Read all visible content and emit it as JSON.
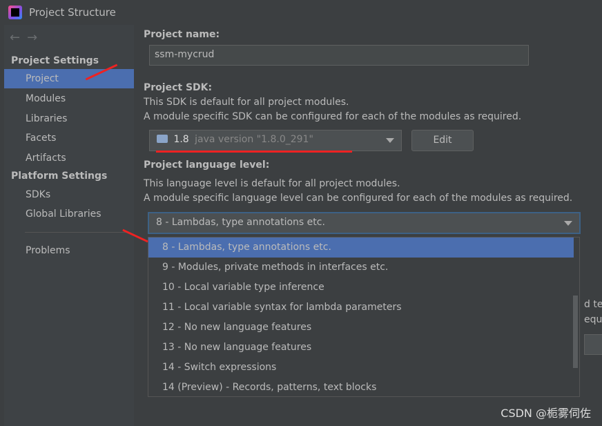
{
  "window": {
    "title": "Project Structure"
  },
  "sidebar": {
    "sections": [
      {
        "label": "Project Settings"
      },
      {
        "label": "Platform Settings"
      }
    ],
    "items": [
      {
        "label": "Project"
      },
      {
        "label": "Modules"
      },
      {
        "label": "Libraries"
      },
      {
        "label": "Facets"
      },
      {
        "label": "Artifacts"
      },
      {
        "label": "SDKs"
      },
      {
        "label": "Global Libraries"
      },
      {
        "label": "Problems"
      }
    ]
  },
  "main": {
    "project_name_label": "Project name:",
    "project_name_value": "ssm-mycrud",
    "sdk_label": "Project SDK:",
    "sdk_desc1": "This SDK is default for all project modules.",
    "sdk_desc2": "A module specific SDK can be configured for each of the modules as required.",
    "sdk_value": "1.8",
    "sdk_detail": "java version \"1.8.0_291\"",
    "edit_label": "Edit",
    "lang_label": "Project language level:",
    "lang_desc1": "This language level is default for all project modules.",
    "lang_desc2": "A module specific language level can be configured for each of the modules as required.",
    "lang_value": "8 - Lambdas, type annotations etc.",
    "hidden_fragment1": "d te",
    "hidden_fragment2": "equi"
  },
  "dropdown": {
    "options": [
      "8 - Lambdas, type annotations etc.",
      "9 - Modules, private methods in interfaces etc.",
      "10 - Local variable type inference",
      "11 - Local variable syntax for lambda parameters",
      "12 - No new language features",
      "13 - No new language features",
      "14 - Switch expressions",
      "14 (Preview) - Records, patterns, text blocks"
    ],
    "selected": 0
  },
  "watermark": "CSDN @栀雾伺佐",
  "colors": {
    "selection": "#4b6eaf",
    "annotation": "#e22222"
  }
}
